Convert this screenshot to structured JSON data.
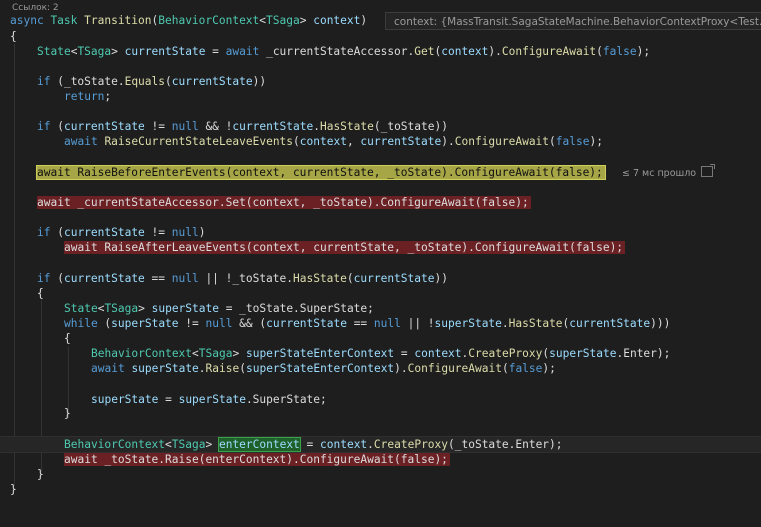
{
  "codelens": "Ссылок: 2",
  "datatip": "context: {MassTransit.SagaStateMachine.BehaviorContextProxy<Test...",
  "perftip": "≤ 7 мс прошло",
  "code": {
    "l1": {
      "kw1": "async",
      "t1": "Task",
      "m1": "Transition",
      "p1": "(",
      "t2": "BehaviorContext",
      "p2": "<",
      "t3": "TSaga",
      "p3": "> ",
      "v1": "context",
      "p4": ")"
    },
    "l2": "{",
    "l3": {
      "t1": "State",
      "p1": "<",
      "t2": "TSaga",
      "p2": "> ",
      "v1": "currentState",
      "p3": " = ",
      "k1": "await",
      "p4": " _currentStateAccessor.",
      "m1": "Get",
      "p5": "(",
      "v2": "context",
      "p6": ").",
      "m2": "ConfigureAwait",
      "p7": "(",
      "k2": "false",
      "p8": ");"
    },
    "l4": {
      "k1": "if",
      "p1": " (_toState.",
      "m1": "Equals",
      "p2": "(",
      "v1": "currentState",
      "p3": "))"
    },
    "l5": {
      "k1": "return",
      "p1": ";"
    },
    "l6": {
      "k1": "if",
      "p1": " (",
      "v1": "currentState",
      "p2": " != ",
      "k2": "null",
      "p3": " && !",
      "v2": "currentState",
      "p4": ".",
      "m1": "HasState",
      "p5": "(_toState))"
    },
    "l7": {
      "k1": "await",
      "p1": " ",
      "m1": "RaiseCurrentStateLeaveEvents",
      "p2": "(",
      "v1": "context",
      "p3": ", ",
      "v2": "currentState",
      "p4": ").",
      "m2": "ConfigureAwait",
      "p5": "(",
      "k2": "false",
      "p6": ");"
    },
    "l8": "await RaiseBeforeEnterEvents(context, currentState, _toState).ConfigureAwait(false);",
    "l9": "await _currentStateAccessor.Set(context, _toState).ConfigureAwait(false);",
    "l10": {
      "k1": "if",
      "p1": " (",
      "v1": "currentState",
      "p2": " != ",
      "k2": "null",
      "p3": ")"
    },
    "l11": "await RaiseAfterLeaveEvents(context, currentState, _toState).ConfigureAwait(false);",
    "l12": {
      "k1": "if",
      "p1": " (",
      "v1": "currentState",
      "p2": " == ",
      "k2": "null",
      "p3": " || !_toState.",
      "m1": "HasState",
      "p4": "(",
      "v2": "currentState",
      "p5": "))"
    },
    "l13": "{",
    "l14": {
      "t1": "State",
      "p1": "<",
      "t2": "TSaga",
      "p2": "> ",
      "v1": "superState",
      "p3": " = _toState.SuperState;"
    },
    "l15": {
      "k1": "while",
      "p1": " (",
      "v1": "superState",
      "p2": " != ",
      "k2": "null",
      "p3": " && (",
      "v2": "currentState",
      "p4": " == ",
      "k3": "null",
      "p5": " || !",
      "v3": "superState",
      "p6": ".",
      "m1": "HasState",
      "p7": "(",
      "v4": "currentState",
      "p8": ")))"
    },
    "l16": "{",
    "l17": {
      "t1": "BehaviorContext",
      "p1": "<",
      "t2": "TSaga",
      "p2": "> ",
      "v1": "superStateEnterContext",
      "p3": " = ",
      "v2": "context",
      "p4": ".",
      "m1": "CreateProxy",
      "p5": "(",
      "v3": "superState",
      "p6": ".Enter);"
    },
    "l18": {
      "k1": "await",
      "p1": " ",
      "v1": "superState",
      "p2": ".",
      "m1": "Raise",
      "p3": "(",
      "v2": "superStateEnterContext",
      "p4": ").",
      "m2": "ConfigureAwait",
      "p5": "(",
      "k2": "false",
      "p6": ");"
    },
    "l19": {
      "v1": "superState",
      "p1": " = ",
      "v2": "superState",
      "p2": ".SuperState;"
    },
    "l20": "}",
    "l21": {
      "t1": "BehaviorContext",
      "p1": "<",
      "t2": "TSaga",
      "p2": "> ",
      "v1": "enterContext",
      "p3": " = ",
      "v2": "context",
      "p4": ".",
      "m1": "CreateProxy",
      "p5": "(_toState.Enter);"
    },
    "l22": "await _toState.Raise(enterContext).ConfigureAwait(false);",
    "l23": "}",
    "l24": "}"
  }
}
